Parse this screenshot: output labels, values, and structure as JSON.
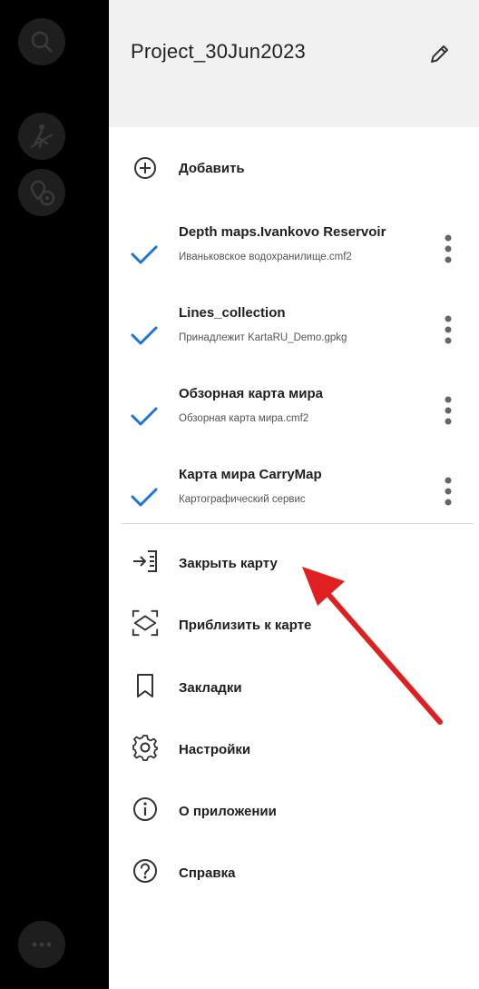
{
  "map_controls": {
    "buttons": [
      {
        "icon": "search-icon"
      },
      {
        "icon": "route-icon"
      },
      {
        "icon": "location-compass-icon"
      },
      {
        "icon": "more-horizontal-icon"
      }
    ],
    "button_bg": "#1e1e1e",
    "icon_color": "#3a3a3a"
  },
  "drawer": {
    "project_title": "Project_30Jun2023",
    "edit_icon": "pencil-icon",
    "add_label": "Добавить",
    "maps": [
      {
        "title": "Depth maps.Ivankovo Reservoir",
        "subtitle": "Иваньковское водохранилище.cmf2",
        "checked": true
      },
      {
        "title": "Lines_collection",
        "subtitle": "Принадлежит KartaRU_Demo.gpkg",
        "checked": true
      },
      {
        "title": "Обзорная карта мира",
        "subtitle": "Обзорная карта мира.cmf2",
        "checked": true
      },
      {
        "title": "Карта мира CarryMap",
        "subtitle": "Картографический сервис",
        "checked": true
      }
    ],
    "menu": [
      {
        "label": "Закрыть карту",
        "icon": "close-map-icon"
      },
      {
        "label": "Приблизить к карте",
        "icon": "zoom-to-map-icon"
      },
      {
        "label": "Закладки",
        "icon": "bookmark-icon"
      },
      {
        "label": "Настройки",
        "icon": "gear-icon"
      },
      {
        "label": "О приложении",
        "icon": "info-icon"
      },
      {
        "label": "Справка",
        "icon": "help-icon"
      }
    ]
  },
  "colors": {
    "accent_check": "#1976d2",
    "header_bg": "#f1f1f1",
    "annotation_arrow": "#e02020"
  }
}
